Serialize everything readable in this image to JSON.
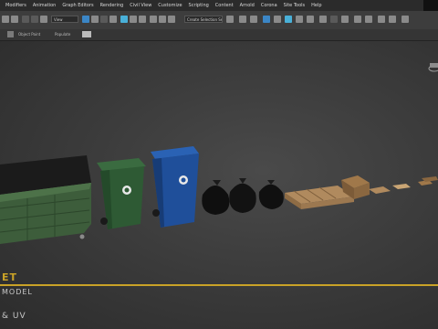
{
  "menubar": {
    "items": [
      "Modifiers",
      "Animation",
      "Graph Editors",
      "Rendering",
      "Civil View",
      "Customize",
      "Scripting",
      "Content",
      "Arnold",
      "Corona",
      "Site Tools",
      "Help"
    ]
  },
  "toolbar": {
    "selection_filter": "View",
    "named_selection_placeholder": "Create Selection Se"
  },
  "ribbon": {
    "object_paint_label": "Object Paint",
    "populate_label": "Populate"
  },
  "overlay": {
    "title_partial": "ET",
    "subtitle_partial": "MODEL",
    "footer_partial": "& UV"
  },
  "colors": {
    "accent_gold": "#c9a227",
    "dumpster_green": "#3d5d3b",
    "bin_green": "#2e5a34",
    "bin_blue": "#1f4f9a",
    "trash_bag": "#0f0f0f",
    "pallet_wood": "#b08a5e",
    "cardboard": "#a0784a"
  },
  "icons": [
    "undo-icon",
    "redo-icon",
    "link-icon",
    "unlink-icon",
    "select-icon",
    "move-icon",
    "rotate-icon",
    "scale-icon",
    "snap-icon",
    "angle-snap-icon",
    "percent-snap-icon",
    "mirror-icon",
    "align-icon",
    "render-setup-icon",
    "render-icon",
    "teapot-icon"
  ]
}
